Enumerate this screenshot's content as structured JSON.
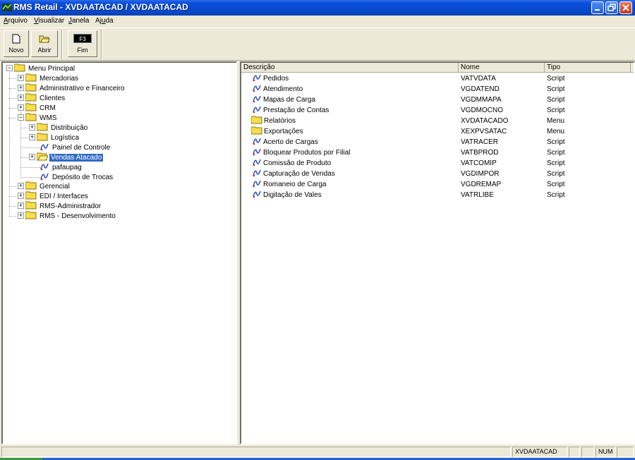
{
  "window": {
    "title": "RMS Retail - XVDAATACAD / XVDAATACAD"
  },
  "menu": {
    "arquivo": {
      "u": "A",
      "rest": "rquivo"
    },
    "visualizar": {
      "u": "V",
      "rest": "isualizar"
    },
    "janela": {
      "u": "J",
      "rest": "anela"
    },
    "ajuda_pre": "Aj",
    "ajuda_u": "u",
    "ajuda_post": "da"
  },
  "toolbar": {
    "novo": "Novo",
    "abrir": "Abrir",
    "fim": "Fim",
    "fim_key": "F3"
  },
  "tree": {
    "root": "Menu Principal",
    "mercadorias": "Mercadorias",
    "admin_fin": "Administrativo e Financeiro",
    "clientes": "Clientes",
    "crm": "CRM",
    "wms": "WMS",
    "distribuicao": "Distribuição",
    "logistica": "Logística",
    "painel": "Painel de Controle",
    "vendas_atacado": "Vendas Atacado",
    "pafaupag": "pafaupag",
    "deposito": "Depósito de Trocas",
    "gerencial": "Gerencial",
    "edi": "EDI / Interfaces",
    "rms_admin": "RMS-Administrador",
    "rms_dev": "RMS - Desenvolvimento"
  },
  "list": {
    "headers": {
      "descricao": "Descrição",
      "nome": "Nome",
      "tipo": "Tipo"
    },
    "rows": [
      {
        "icon": "script-icon",
        "descricao": "Pedidos",
        "nome": "VATVDATA",
        "tipo": "Script"
      },
      {
        "icon": "script-icon",
        "descricao": "Atendimento",
        "nome": "VGDATEND",
        "tipo": "Script"
      },
      {
        "icon": "script-icon",
        "descricao": "Mapas de Carga",
        "nome": "VGDMMAPA",
        "tipo": "Script"
      },
      {
        "icon": "script-icon",
        "descricao": "Prestação de Contas",
        "nome": "VGDMOCNO",
        "tipo": "Script"
      },
      {
        "icon": "folder-icon",
        "descricao": "Relatórios",
        "nome": "XVDATACADO",
        "tipo": "Menu"
      },
      {
        "icon": "folder-icon",
        "descricao": "Exportações",
        "nome": "XEXPVSATAC",
        "tipo": "Menu"
      },
      {
        "icon": "script-icon",
        "descricao": "Acerto de Cargas",
        "nome": "VATRACER",
        "tipo": "Script"
      },
      {
        "icon": "script-icon",
        "descricao": "Bloquear Produtos por Filial",
        "nome": "VATBPROD",
        "tipo": "Script"
      },
      {
        "icon": "script-icon",
        "descricao": "Comissão de Produto",
        "nome": "VATCOMIP",
        "tipo": "Script"
      },
      {
        "icon": "script-icon",
        "descricao": "Capturação de Vendas",
        "nome": "VGDIMPOR",
        "tipo": "Script"
      },
      {
        "icon": "script-icon",
        "descricao": "Romaneio de Carga",
        "nome": "VGDREMAP",
        "tipo": "Script"
      },
      {
        "icon": "script-icon",
        "descricao": "Digitação de Vales",
        "nome": "VATRLIBE",
        "tipo": "Script"
      }
    ]
  },
  "status": {
    "user": "XVDAATACAD",
    "num": "NUM"
  }
}
